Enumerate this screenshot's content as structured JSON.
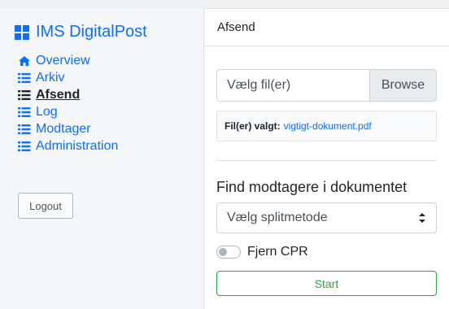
{
  "app": {
    "title": "IMS DigitalPost",
    "brand_color": "#0d6efd"
  },
  "sidebar": {
    "items": [
      {
        "label": "Overview",
        "icon": "home-icon",
        "active": false
      },
      {
        "label": "Arkiv",
        "icon": "list-icon",
        "active": false
      },
      {
        "label": "Afsend",
        "icon": "list-icon",
        "active": true
      },
      {
        "label": "Log",
        "icon": "list-icon",
        "active": false
      },
      {
        "label": "Modtager",
        "icon": "list-icon",
        "active": false
      },
      {
        "label": "Administration",
        "icon": "list-icon",
        "active": false
      }
    ],
    "logout_label": "Logout"
  },
  "main": {
    "header": "Afsend",
    "file_input": {
      "placeholder": "Vælg fil(er)",
      "browse_label": "Browse"
    },
    "selected": {
      "label": "Fil(er) valgt:",
      "file": "vigtigt-dokument.pdf"
    },
    "find_title": "Find modtagere i dokumentet",
    "split_select": {
      "value": "Vælg splitmetode"
    },
    "remove_cpr": {
      "label": "Fjern CPR",
      "checked": false
    },
    "start_label": "Start",
    "start_color": "#28a745"
  }
}
